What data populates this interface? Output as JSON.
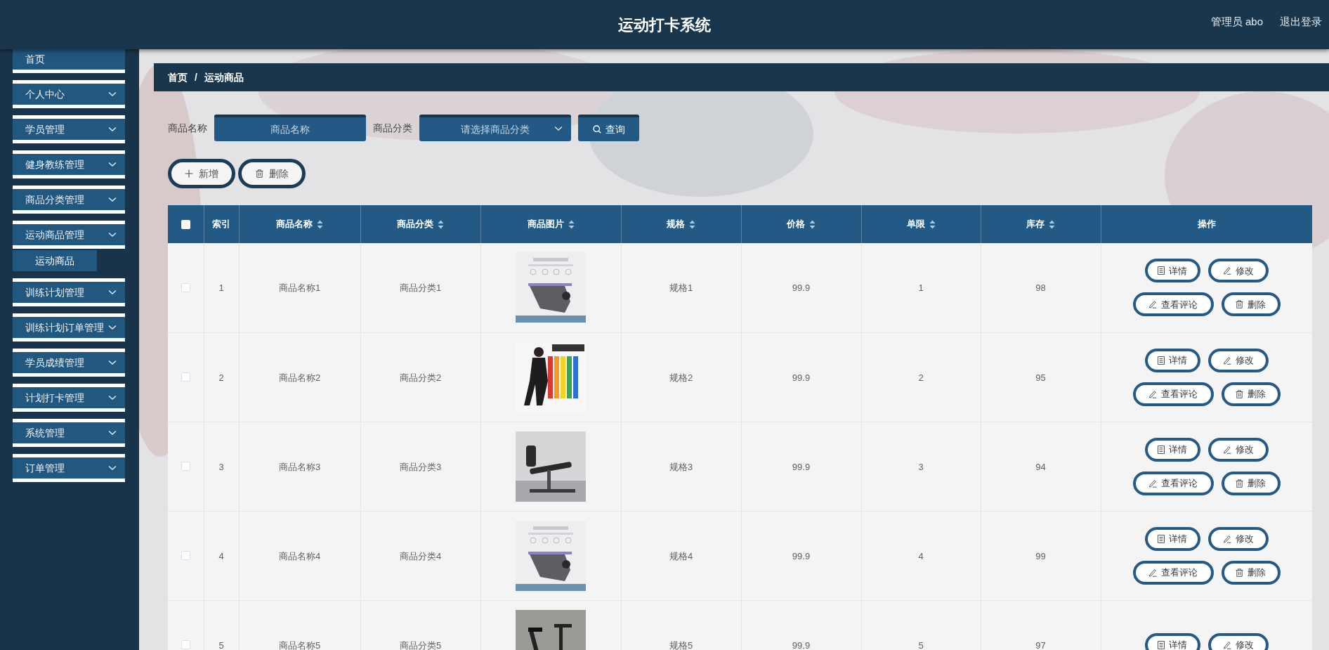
{
  "header": {
    "title": "运动打卡系统",
    "user": "管理员 abo",
    "logout": "退出登录"
  },
  "sidebar": {
    "items": [
      {
        "label": "首页",
        "kind": "link"
      },
      {
        "label": "个人中心",
        "kind": "menu"
      },
      {
        "label": "学员管理",
        "kind": "menu"
      },
      {
        "label": "健身教练管理",
        "kind": "menu"
      },
      {
        "label": "商品分类管理",
        "kind": "menu"
      },
      {
        "label": "运动商品管理",
        "kind": "menu",
        "children": [
          {
            "label": "运动商品",
            "selected": true
          }
        ]
      },
      {
        "label": "训练计划管理",
        "kind": "menu"
      },
      {
        "label": "训练计划订单管理",
        "kind": "menu"
      },
      {
        "label": "学员成绩管理",
        "kind": "menu"
      },
      {
        "label": "计划打卡管理",
        "kind": "menu"
      },
      {
        "label": "系统管理",
        "kind": "menu"
      },
      {
        "label": "订单管理",
        "kind": "menu"
      }
    ]
  },
  "background": {
    "kind": "picture"
  },
  "breadcrumb": {
    "items": [
      "首页",
      "运动商品"
    ],
    "separator": "/"
  },
  "search": {
    "fields": [
      {
        "label": "商品名称",
        "kind": "input",
        "placeholder": "商品名称"
      },
      {
        "label": "商品分类",
        "kind": "select",
        "placeholder": "请选择商品分类"
      }
    ],
    "button": "查询"
  },
  "actions": [
    {
      "label": "新增",
      "kind": "add"
    },
    {
      "label": "删除",
      "kind": "delete"
    }
  ],
  "table": {
    "select_all": {
      "checked": false
    },
    "columns": [
      {
        "label": "索引",
        "sortable": false
      },
      {
        "label": "商品名称",
        "sortable": true
      },
      {
        "label": "商品分类",
        "sortable": true
      },
      {
        "label": "商品图片",
        "sortable": true
      },
      {
        "label": "规格",
        "sortable": true
      },
      {
        "label": "价格",
        "sortable": true
      },
      {
        "label": "单限",
        "sortable": true
      },
      {
        "label": "库存",
        "sortable": true
      },
      {
        "label": "操作",
        "sortable": false
      }
    ],
    "rows": [
      {
        "checked": false,
        "index": "1",
        "name": "商品名称1",
        "category": "商品分类1",
        "image": {
          "kind": "picture"
        },
        "spec": "规格1",
        "price": "99.9",
        "limit": "1",
        "stock": "98",
        "actions": [
          {
            "label": "详情",
            "kind": "detail"
          },
          {
            "label": "修改",
            "kind": "edit"
          },
          {
            "label": "查看评论",
            "kind": "comment"
          },
          {
            "label": "删除",
            "kind": "delete"
          }
        ]
      },
      {
        "checked": false,
        "index": "2",
        "name": "商品名称2",
        "category": "商品分类2",
        "image": {
          "kind": "picture"
        },
        "spec": "规格2",
        "price": "99.9",
        "limit": "2",
        "stock": "95",
        "actions": [
          {
            "label": "详情",
            "kind": "detail"
          },
          {
            "label": "修改",
            "kind": "edit"
          },
          {
            "label": "查看评论",
            "kind": "comment"
          },
          {
            "label": "删除",
            "kind": "delete"
          }
        ]
      },
      {
        "checked": false,
        "index": "3",
        "name": "商品名称3",
        "category": "商品分类3",
        "image": {
          "kind": "picture"
        },
        "spec": "规格3",
        "price": "99.9",
        "limit": "3",
        "stock": "94",
        "actions": [
          {
            "label": "详情",
            "kind": "detail"
          },
          {
            "label": "修改",
            "kind": "edit"
          },
          {
            "label": "查看评论",
            "kind": "comment"
          },
          {
            "label": "删除",
            "kind": "delete"
          }
        ]
      },
      {
        "checked": false,
        "index": "4",
        "name": "商品名称4",
        "category": "商品分类4",
        "image": {
          "kind": "picture"
        },
        "spec": "规格4",
        "price": "99.9",
        "limit": "4",
        "stock": "99",
        "actions": [
          {
            "label": "详情",
            "kind": "detail"
          },
          {
            "label": "修改",
            "kind": "edit"
          },
          {
            "label": "查看评论",
            "kind": "comment"
          },
          {
            "label": "删除",
            "kind": "delete"
          }
        ]
      },
      {
        "checked": false,
        "index": "5",
        "name": "商品名称5",
        "category": "商品分类5",
        "image": {
          "kind": "picture"
        },
        "spec": "规格5",
        "price": "99.9",
        "limit": "5",
        "stock": "97",
        "actions": [
          {
            "label": "详情",
            "kind": "detail"
          },
          {
            "label": "修改",
            "kind": "edit"
          }
        ]
      }
    ]
  }
}
